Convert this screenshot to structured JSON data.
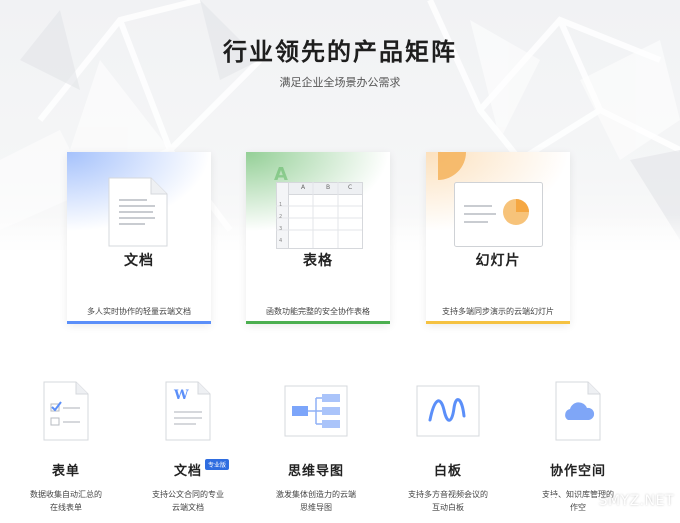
{
  "hero": {
    "title": "行业领先的产品矩阵",
    "subtitle": "满足企业全场景办公需求"
  },
  "products": [
    {
      "name": "文档",
      "desc": "多人实时协作的轻量云端文档",
      "accent": "#5b8ff9",
      "icon": "document-icon"
    },
    {
      "name": "表格",
      "desc": "函数功能完整的安全协作表格",
      "accent": "#4caf50",
      "icon": "spreadsheet-icon"
    },
    {
      "name": "幻灯片",
      "desc": "支持多端同步演示的云端幻灯片",
      "accent": "#f5c242",
      "icon": "slides-icon"
    }
  ],
  "spreadsheet_preview": {
    "columns": [
      "A",
      "B",
      "C"
    ],
    "rows": [
      "1",
      "2",
      "3",
      "4"
    ],
    "big_letter": "A"
  },
  "tools": [
    {
      "name": "表单",
      "desc_line1": "数据收集自动汇总的",
      "desc_line2": "在线表单",
      "icon": "form-checklist-icon"
    },
    {
      "name": "文档",
      "desc_line1": "支持公文合同的专业",
      "desc_line2": "云端文档",
      "icon": "word-document-icon",
      "badge": "专业版",
      "doc_letter": "W"
    },
    {
      "name": "思维导图",
      "desc_line1": "激发集体创造力的云端",
      "desc_line2": "思维导图",
      "icon": "mind-map-icon"
    },
    {
      "name": "白板",
      "desc_line1": "支持多方音视频会议的",
      "desc_line2": "互动白板",
      "icon": "whiteboard-icon"
    },
    {
      "name": "协作空间",
      "desc_line1": "支持、知识库管理的",
      "desc_line2": "作空",
      "icon": "cloud-folder-icon"
    }
  ],
  "watermark": {
    "text": "SMYZ.NET",
    "icon": "watermark-logo-icon"
  },
  "colors": {
    "doc_blue": "#5b8ff9",
    "sheet_green": "#4caf50",
    "slide_orange": "#f5a742",
    "badge_blue": "#2f6de0"
  }
}
